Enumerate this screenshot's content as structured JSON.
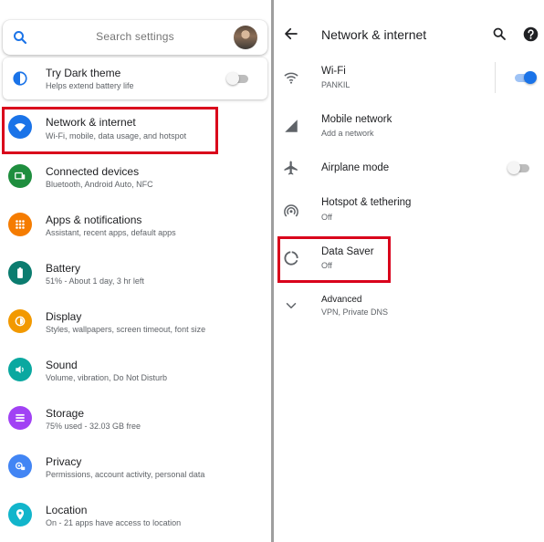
{
  "search": {
    "placeholder": "Search settings",
    "icon": "search-icon"
  },
  "dark_theme": {
    "title": "Try Dark theme",
    "subtitle": "Helps extend battery life",
    "enabled": false
  },
  "settings": [
    {
      "title": "Network & internet",
      "subtitle": "Wi-Fi, mobile, data usage, and hotspot",
      "icon": "wifi-icon",
      "color": "#1a73e8"
    },
    {
      "title": "Connected devices",
      "subtitle": "Bluetooth, Android Auto, NFC",
      "icon": "devices-icon",
      "color": "#1e8e3e"
    },
    {
      "title": "Apps & notifications",
      "subtitle": "Assistant, recent apps, default apps",
      "icon": "apps-icon",
      "color": "#f57c00"
    },
    {
      "title": "Battery",
      "subtitle": "51% - About 1 day, 3 hr left",
      "icon": "battery-icon",
      "color": "#0b7c6f"
    },
    {
      "title": "Display",
      "subtitle": "Styles, wallpapers, screen timeout, font size",
      "icon": "display-icon",
      "color": "#f29900"
    },
    {
      "title": "Sound",
      "subtitle": "Volume, vibration, Do Not Disturb",
      "icon": "sound-icon",
      "color": "#0aa8a0"
    },
    {
      "title": "Storage",
      "subtitle": "75% used - 32.03 GB free",
      "icon": "storage-icon",
      "color": "#a142f4"
    },
    {
      "title": "Privacy",
      "subtitle": "Permissions, account activity, personal data",
      "icon": "privacy-icon",
      "color": "#4285f4"
    },
    {
      "title": "Location",
      "subtitle": "On - 21 apps have access to location",
      "icon": "location-icon",
      "color": "#12b5cb"
    }
  ],
  "network": {
    "title": "Network & internet",
    "items": [
      {
        "title": "Wi-Fi",
        "subtitle": "PANKIL",
        "icon": "wifi-icon",
        "toggle": true
      },
      {
        "title": "Mobile network",
        "subtitle": "Add a network",
        "icon": "signal-icon"
      },
      {
        "title": "Airplane mode",
        "subtitle": "",
        "icon": "airplane-icon",
        "toggle": false
      },
      {
        "title": "Hotspot & tethering",
        "subtitle": "Off",
        "icon": "hotspot-icon"
      },
      {
        "title": "Data Saver",
        "subtitle": "Off",
        "icon": "data-saver-icon"
      },
      {
        "title": "Advanced",
        "subtitle": "VPN, Private DNS",
        "icon": "chevron-down-icon"
      }
    ]
  },
  "colors": {
    "highlight": "#d9001b",
    "accent": "#1a73e8"
  }
}
